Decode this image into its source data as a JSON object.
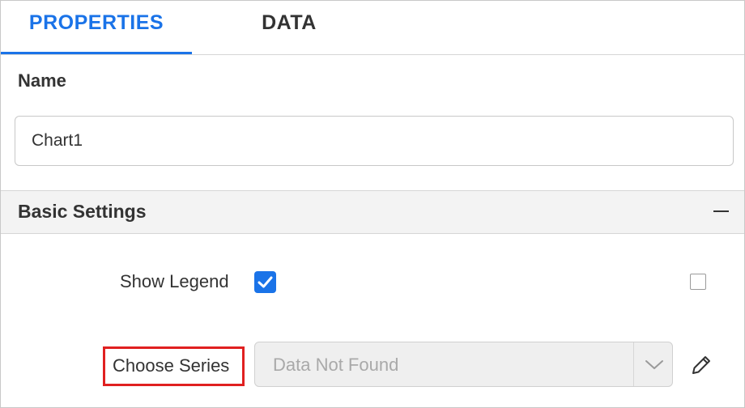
{
  "tabs": {
    "properties": "PROPERTIES",
    "data": "DATA",
    "active": "properties"
  },
  "name_section": {
    "label": "Name",
    "value": "Chart1"
  },
  "basic_settings": {
    "title": "Basic Settings",
    "show_legend": {
      "label": "Show Legend",
      "checked": true
    },
    "side_checkbox_checked": false,
    "choose_series": {
      "label": "Choose Series",
      "value": "Data Not Found",
      "disabled": true
    }
  },
  "colors": {
    "accent": "#1a73e8",
    "highlight_border": "#e02020",
    "header_bg": "#f3f3f3",
    "disabled_bg": "#efefef"
  },
  "icons": [
    "checkmark-icon",
    "collapse-minus-icon",
    "chevron-down-icon",
    "pencil-edit-icon"
  ]
}
